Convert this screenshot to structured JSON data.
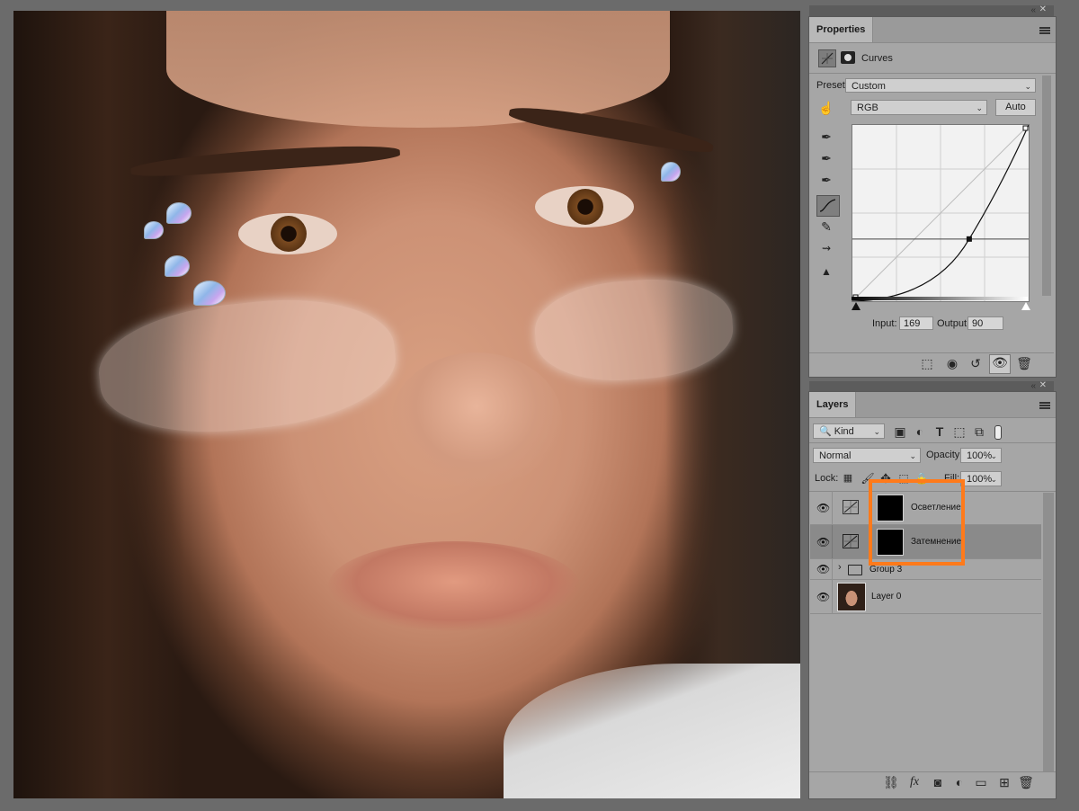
{
  "properties": {
    "tab_title": "Properties",
    "adjustment_name": "Curves",
    "preset_label": "Preset:",
    "preset_value": "Custom",
    "channel_value": "RGB",
    "auto_label": "Auto",
    "input_label": "Input:",
    "input_value": "169",
    "output_label": "Output:",
    "output_value": "90",
    "curve_point": {
      "input": 169,
      "output": 90
    }
  },
  "layers": {
    "tab_title": "Layers",
    "filter_kind": "Kind",
    "blend_mode": "Normal",
    "opacity_label": "Opacity:",
    "opacity_value": "100%",
    "lock_label": "Lock:",
    "fill_label": "Fill:",
    "fill_value": "100%",
    "items": [
      {
        "name": "Осветление",
        "type": "curves-adjustment",
        "visible": true,
        "selected": false
      },
      {
        "name": "Затемнение",
        "type": "curves-adjustment",
        "visible": true,
        "selected": true
      },
      {
        "name": "Group 3",
        "type": "group",
        "visible": true,
        "selected": false
      },
      {
        "name": "Layer 0",
        "type": "image",
        "visible": true,
        "selected": false
      }
    ]
  },
  "highlight_color": "#ff7a1a"
}
